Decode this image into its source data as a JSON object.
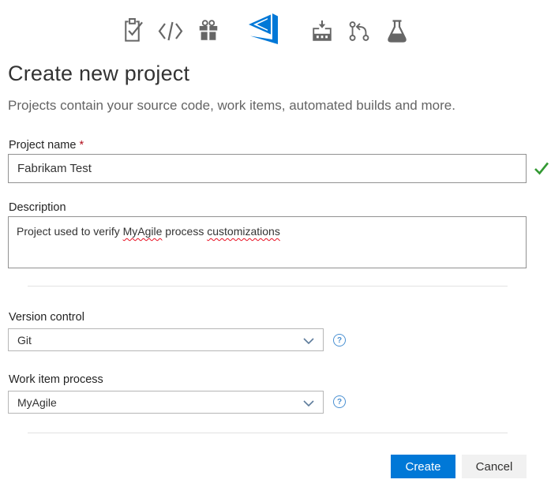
{
  "header": {
    "title": "Create new project",
    "subtitle": "Projects contain your source code, work items, automated builds and more."
  },
  "toolbar_icons": [
    {
      "name": "checklist-icon"
    },
    {
      "name": "code-icon"
    },
    {
      "name": "gift-icon"
    },
    {
      "name": "vsts-logo-icon"
    },
    {
      "name": "build-icon"
    },
    {
      "name": "branch-icon"
    },
    {
      "name": "flask-icon"
    }
  ],
  "form": {
    "project_name": {
      "label": "Project name",
      "required_marker": "*",
      "value": "Fabrikam Test",
      "validation": "valid"
    },
    "description": {
      "label": "Description",
      "value": "Project used to verify MyAgile process customizations",
      "segments": [
        {
          "text": "Project used to verify ",
          "misspelled": false
        },
        {
          "text": "MyAgile",
          "misspelled": true
        },
        {
          "text": " process ",
          "misspelled": false
        },
        {
          "text": "customizations",
          "misspelled": true
        }
      ]
    },
    "version_control": {
      "label": "Version control",
      "value": "Git"
    },
    "work_item_process": {
      "label": "Work item process",
      "value": "MyAgile"
    }
  },
  "help_icon_glyph": "?",
  "actions": {
    "create_label": "Create",
    "cancel_label": "Cancel"
  },
  "colors": {
    "accent_blue": "#0078d7",
    "icon_gray": "#666666",
    "valid_green": "#339933",
    "required_red": "#b10e1c",
    "spellcheck_red": "#e81123",
    "help_blue": "#4a90d2",
    "divider_gray": "#e2e2e2"
  }
}
